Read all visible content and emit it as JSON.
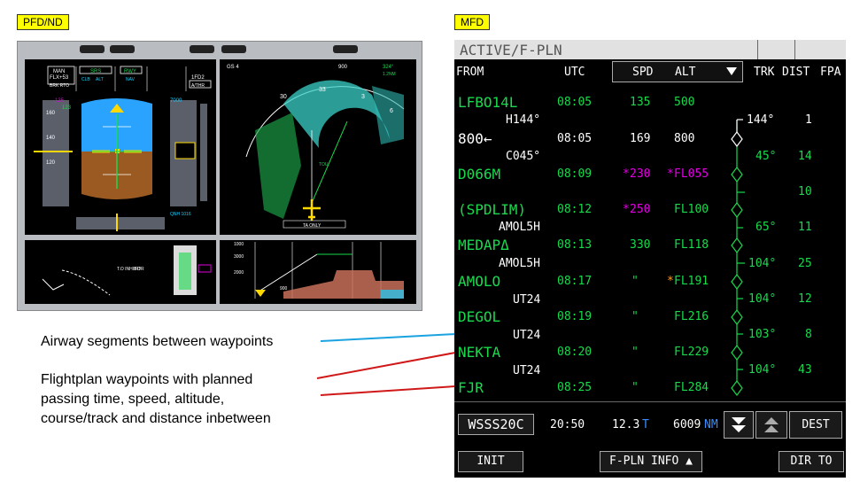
{
  "labels": {
    "pfd_nd": "PFD/ND",
    "mfd": "MFD"
  },
  "annotations": {
    "airway": "Airway segments between waypoints",
    "flightplan_1": "Flightplan waypoints with planned",
    "flightplan_2": "passing time, speed, altitude,",
    "flightplan_3": "course/track and distance inbetween"
  },
  "pfd": {
    "fma_man": "MAN",
    "fma_flx": "FLX+53",
    "fma_brk": "BRK RTO",
    "fma_srs": "SRS",
    "fma_rwy": "RWY",
    "fma_clb": "CLB",
    "fma_alt": "ALT",
    "fma_nav": "NAV",
    "fma_1fd2": "1FD2",
    "fma_athr": "A/THR",
    "spd_135": "135",
    "spd_123": "123",
    "spd_160": "160",
    "spd_140": "140",
    "spd_120": "120",
    "alt_7000": "7000",
    "qnh": "QNH 1016",
    "nd_gs": "GS 4",
    "nd_900": "900",
    "nd_324": "324°",
    "nd_12nm": "1.2NM",
    "nd_ta_only": "TA ONLY",
    "nd_tou": "TOU",
    "nd_30": "30",
    "nd_33": "33",
    "nd_3": "3",
    "nd_6": "6",
    "ecam_toinhibit": "T.O INHIBIT",
    "ecam_for": "FOR",
    "vd_1000": "1000",
    "vd_3000": "3000",
    "vd_2000": "2000",
    "vd_900": "900"
  },
  "mfd": {
    "title": "ACTIVE/F-PLN",
    "headers": {
      "from": "FROM",
      "utc": "UTC",
      "spd": "SPD",
      "alt": "ALT",
      "trk": "TRK",
      "dist": "DIST",
      "fpa": "FPA"
    },
    "rows": [
      {
        "wpt": "LFBO14L",
        "utc": "08:05",
        "spd": "135",
        "spd_star": "",
        "alt": "500",
        "alt_star": ""
      },
      {
        "wpt": "800←",
        "utc": "08:05",
        "spd": "169",
        "spd_star": "",
        "alt": "800",
        "alt_star": ""
      },
      {
        "wpt": "D066M",
        "utc": "08:09",
        "spd": "230",
        "spd_star": "*",
        "alt": "FL055",
        "alt_star": "*"
      },
      {
        "wpt": "(SPDLIM)",
        "utc": "08:12",
        "spd": "250",
        "spd_star": "*",
        "alt": "FL100",
        "alt_star": ""
      },
      {
        "wpt": "MEDAPΔ",
        "utc": "08:13",
        "spd": "330",
        "spd_star": "",
        "alt": "FL118",
        "alt_star": ""
      },
      {
        "wpt": "AMOLO",
        "utc": "08:17",
        "spd": "\"",
        "spd_star": "",
        "alt": "FL191",
        "alt_star": "*"
      },
      {
        "wpt": "DEGOL",
        "utc": "08:19",
        "spd": "\"",
        "spd_star": "",
        "alt": "FL216",
        "alt_star": ""
      },
      {
        "wpt": "NEKTA",
        "utc": "08:20",
        "spd": "\"",
        "spd_star": "",
        "alt": "FL229",
        "alt_star": ""
      },
      {
        "wpt": "FJR",
        "utc": "08:25",
        "spd": "\"",
        "spd_star": "",
        "alt": "FL284",
        "alt_star": ""
      }
    ],
    "airways": [
      "H144°",
      "C045°",
      "AMOL5H",
      "AMOL5H",
      "UT24",
      "UT24",
      "UT24"
    ],
    "legs": [
      {
        "trk": "144°",
        "dist": "1"
      },
      {
        "trk": "45°",
        "dist": "14"
      },
      {
        "trk": "",
        "dist": "10"
      },
      {
        "trk": "65°",
        "dist": "11"
      },
      {
        "trk": "104°",
        "dist": "25"
      },
      {
        "trk": "104°",
        "dist": "12"
      },
      {
        "trk": "103°",
        "dist": "8"
      },
      {
        "trk": "104°",
        "dist": "43"
      }
    ],
    "footer": {
      "dest_id": "WSSS20C",
      "time": "20:50",
      "efob": "12.3",
      "efob_unit": "T",
      "dist": "6009",
      "dist_unit": "NM",
      "dest_btn": "DEST"
    },
    "buttons": {
      "init": "INIT",
      "fpln_info": "F-PLN INFO ▲",
      "dir_to": "DIR TO"
    }
  },
  "colors": {
    "tag": "#ffff00",
    "waypoint": "#19d94d",
    "constraint_magenta": "#e000e0",
    "constraint_amber": "#ff9a1a",
    "airway_line": "#1aa3e0",
    "leader_line": "#d01818"
  }
}
